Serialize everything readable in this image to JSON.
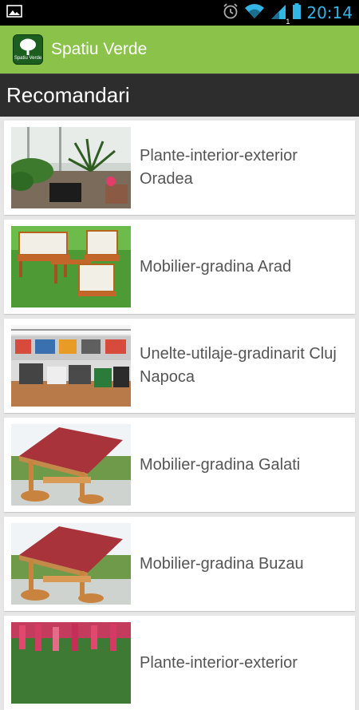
{
  "status_bar": {
    "time": "20:14",
    "signal_sub": "1"
  },
  "app": {
    "title": "Spatiu Verde",
    "icon_label": "Spatiu Verde"
  },
  "section": {
    "title": "Recomandari"
  },
  "items": [
    {
      "label": "Plante-interior-exterior Oradea",
      "image": "plants-interior-image"
    },
    {
      "label": "Mobilier-gradina Arad",
      "image": "garden-furniture-image"
    },
    {
      "label": "Unelte-utilaje-gradinarit Cluj Napoca",
      "image": "garden-tools-image"
    },
    {
      "label": "Mobilier-gradina Galati",
      "image": "gazebo-bench-image"
    },
    {
      "label": "Mobilier-gradina Buzau",
      "image": "gazebo-bench-image"
    },
    {
      "label": "Plante-interior-exterior",
      "image": "flowers-image"
    }
  ]
}
